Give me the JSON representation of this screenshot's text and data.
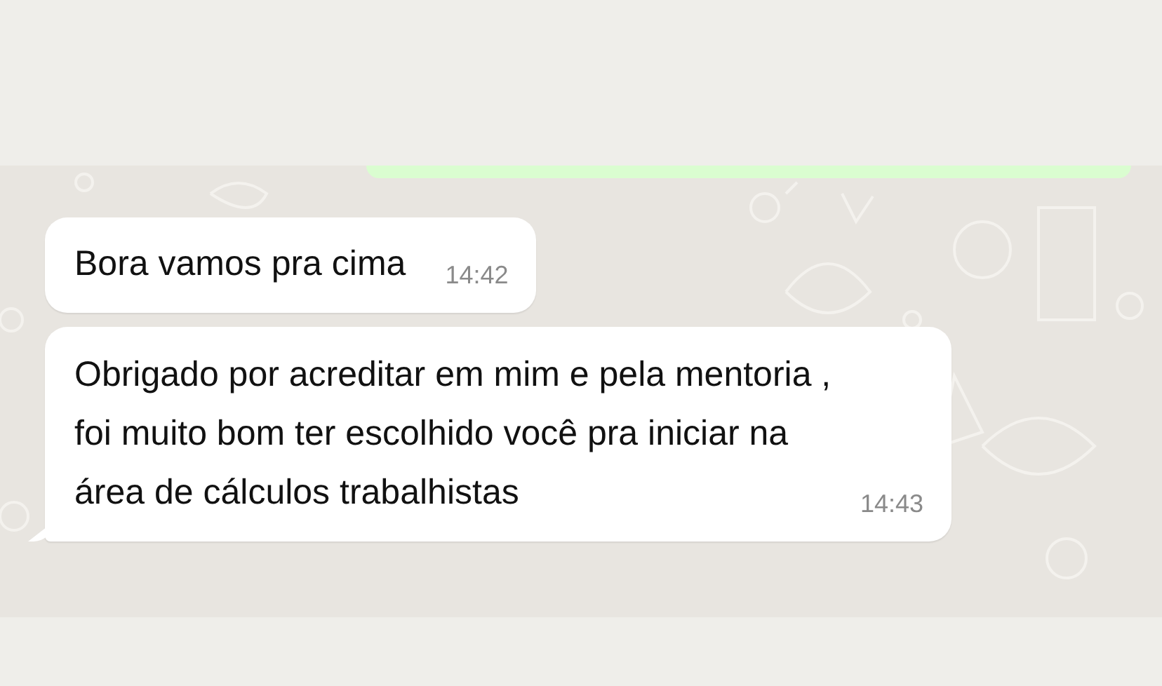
{
  "messages": [
    {
      "kind": "outgoing"
    },
    {
      "kind": "incoming",
      "text": "Bora vamos pra cima",
      "time": "14:42",
      "tail": false
    },
    {
      "kind": "incoming",
      "text": "Obrigado por acreditar em mim e pela mentoria , foi muito bom ter escolhido você pra iniciar na área de cálculos trabalhistas",
      "time": "14:43",
      "tail": true
    }
  ]
}
